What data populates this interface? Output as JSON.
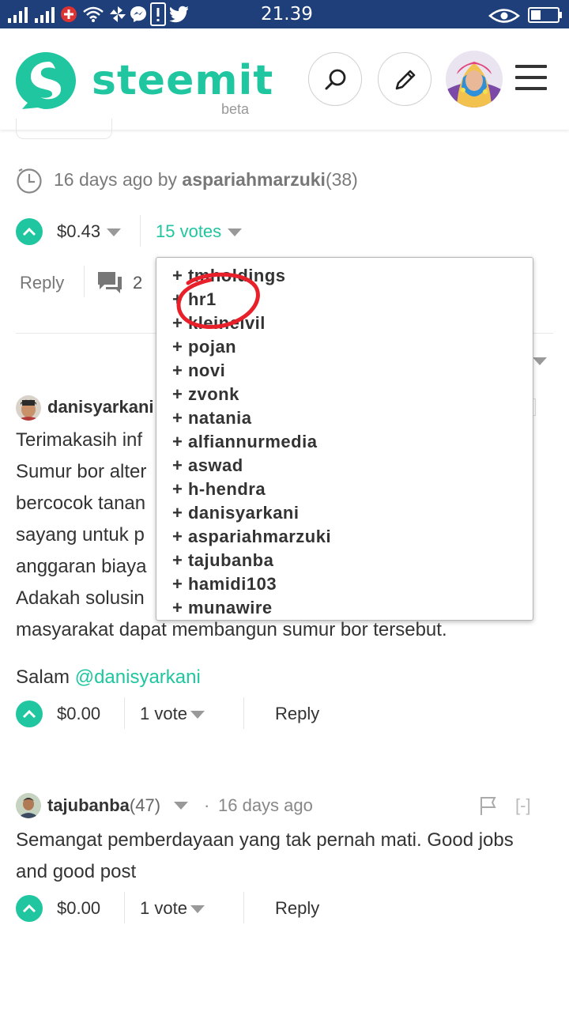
{
  "status_bar": {
    "time": "21.39"
  },
  "header": {
    "logo_text": "steemit",
    "logo_sub": "beta",
    "icons": [
      "search-icon",
      "pencil-icon",
      "hamburger-icon"
    ]
  },
  "post": {
    "time_ago": "16 days ago by",
    "author": "aspariahmarzuki",
    "reputation": "(38)",
    "payout": "$0.43",
    "votes_label": "15 votes",
    "reply_label": "Reply",
    "comments_count": "2"
  },
  "votes_dropdown": {
    "items": [
      "+ tmholdings",
      "+ hr1",
      "+ kleinelvil",
      "+ pojan",
      "+ novi",
      "+ zvonk",
      "+ natania",
      "+ alfiannurmedia",
      "+ aswad",
      "+ h-hendra",
      "+ danisyarkani",
      "+ aspariahmarzuki",
      "+ tajubanba",
      "+ hamidi103",
      "+ munawire"
    ]
  },
  "comment1": {
    "author": "danisyarkani",
    "lines": [
      "Terimakasih inf",
      "Sumur bor alter",
      "bercocok tanan",
      "sayang untuk p",
      "anggaran biaya",
      "Adakah solusin",
      "masyarakat dapat membangun sumur bor tersebut."
    ],
    "salam": "Salam ",
    "mention": "@danisyarkani",
    "payout": "$0.00",
    "votes": "1 vote",
    "reply": "Reply"
  },
  "comment2": {
    "author": "tajubanba",
    "reputation": "(47)",
    "dot": "·",
    "time_ago": "16 days ago",
    "collapse": "[-]",
    "lines": [
      "Semangat pemberdayaan yang tak pernah mati. Good jobs",
      "and good post"
    ],
    "payout": "$0.00",
    "votes": "1 vote",
    "reply": "Reply"
  },
  "colors": {
    "accent": "#1fc6a0",
    "status_bar": "#1e3f7a",
    "annotation": "#e8202a"
  }
}
